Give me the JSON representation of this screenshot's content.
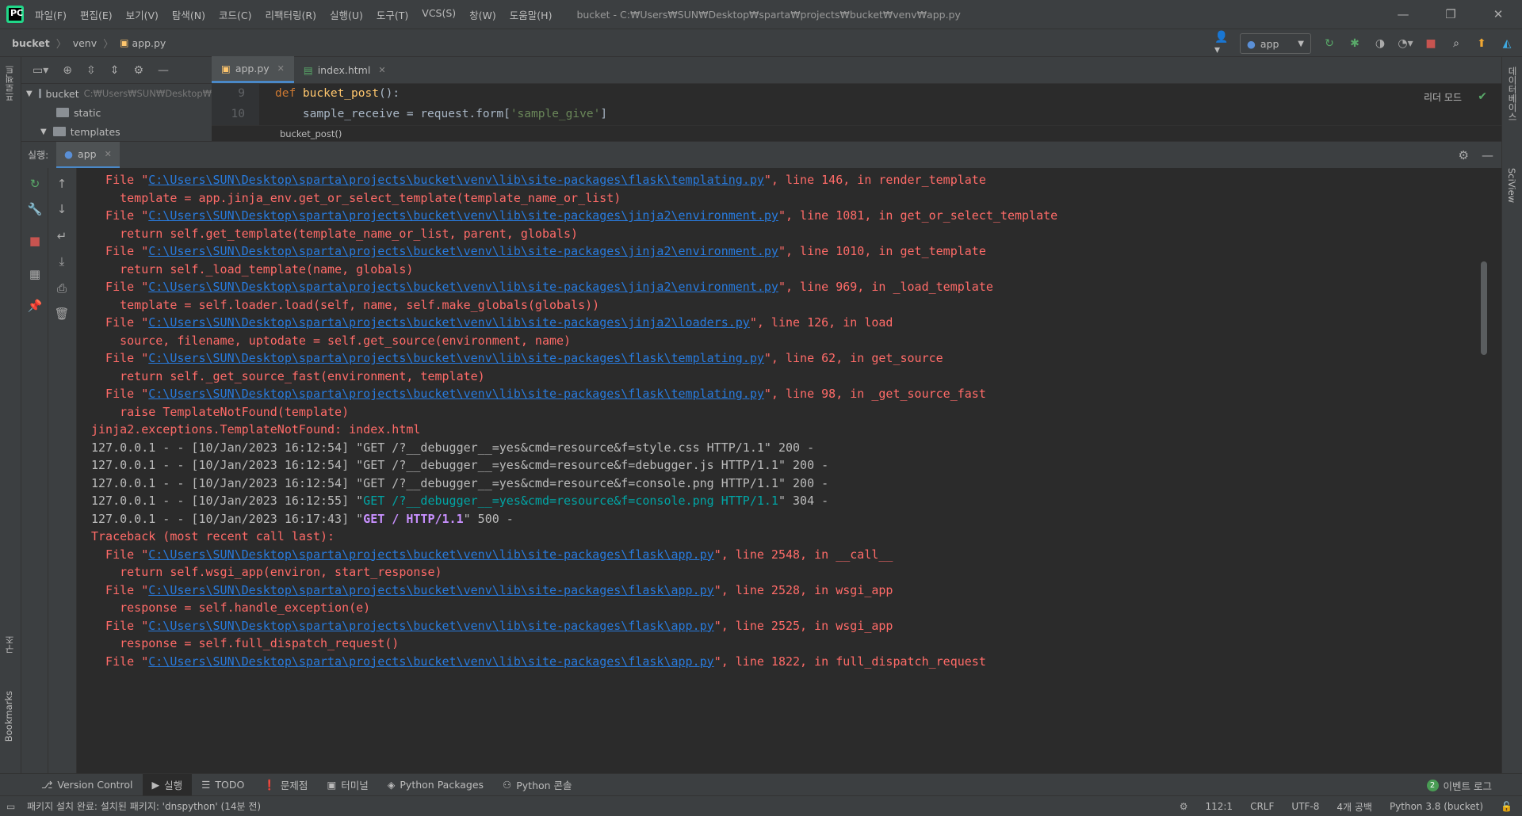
{
  "menu": [
    "파일(F)",
    "편집(E)",
    "보기(V)",
    "탐색(N)",
    "코드(C)",
    "리팩터링(R)",
    "실행(U)",
    "도구(T)",
    "VCS(S)",
    "창(W)",
    "도움말(H)"
  ],
  "window_title": "bucket - C:₩Users₩SUN₩Desktop₩sparta₩projects₩bucket₩venv₩app.py",
  "breadcrumb": [
    "bucket",
    "venv",
    "app.py"
  ],
  "run_config": "app",
  "left_strip": {
    "project": "프로젝트",
    "structure": "구조",
    "bookmarks": "Bookmarks"
  },
  "right_strip": {
    "database": "데이터베이스",
    "sciview": "SciView"
  },
  "editor_tabs": [
    {
      "label": "app.py"
    },
    {
      "label": "index.html"
    }
  ],
  "project_tree": {
    "root": "bucket",
    "root_path": "C:₩Users₩SUN₩Desktop₩",
    "items": [
      "static",
      "templates"
    ]
  },
  "editor": {
    "lines": [
      {
        "no": "9",
        "code": "def bucket_post():"
      },
      {
        "no": "10",
        "code": "    sample_receive = request.form['sample_give']"
      }
    ],
    "reader_mode": "리더 모드",
    "breadcrumb_fn": "bucket_post()"
  },
  "run_window": {
    "label": "실행:",
    "tab": "app"
  },
  "console": [
    {
      "kind": "file",
      "path": "C:\\Users\\SUN\\Desktop\\sparta\\projects\\bucket\\venv\\lib\\site-packages\\flask\\templating.py",
      "rest": "\", line 146, in render_template"
    },
    {
      "kind": "code",
      "text": "    template = app.jinja_env.get_or_select_template(template_name_or_list)"
    },
    {
      "kind": "file",
      "path": "C:\\Users\\SUN\\Desktop\\sparta\\projects\\bucket\\venv\\lib\\site-packages\\jinja2\\environment.py",
      "rest": "\", line 1081, in get_or_select_template"
    },
    {
      "kind": "code",
      "text": "    return self.get_template(template_name_or_list, parent, globals)"
    },
    {
      "kind": "file",
      "path": "C:\\Users\\SUN\\Desktop\\sparta\\projects\\bucket\\venv\\lib\\site-packages\\jinja2\\environment.py",
      "rest": "\", line 1010, in get_template"
    },
    {
      "kind": "code",
      "text": "    return self._load_template(name, globals)"
    },
    {
      "kind": "file",
      "path": "C:\\Users\\SUN\\Desktop\\sparta\\projects\\bucket\\venv\\lib\\site-packages\\jinja2\\environment.py",
      "rest": "\", line 969, in _load_template"
    },
    {
      "kind": "code",
      "text": "    template = self.loader.load(self, name, self.make_globals(globals))"
    },
    {
      "kind": "file",
      "path": "C:\\Users\\SUN\\Desktop\\sparta\\projects\\bucket\\venv\\lib\\site-packages\\jinja2\\loaders.py",
      "rest": "\", line 126, in load"
    },
    {
      "kind": "code",
      "text": "    source, filename, uptodate = self.get_source(environment, name)"
    },
    {
      "kind": "file",
      "path": "C:\\Users\\SUN\\Desktop\\sparta\\projects\\bucket\\venv\\lib\\site-packages\\flask\\templating.py",
      "rest": "\", line 62, in get_source"
    },
    {
      "kind": "code",
      "text": "    return self._get_source_fast(environment, template)"
    },
    {
      "kind": "file",
      "path": "C:\\Users\\SUN\\Desktop\\sparta\\projects\\bucket\\venv\\lib\\site-packages\\flask\\templating.py",
      "rest": "\", line 98, in _get_source_fast"
    },
    {
      "kind": "code",
      "text": "    raise TemplateNotFound(template)"
    },
    {
      "kind": "plain",
      "text": "jinja2.exceptions.TemplateNotFound: index.html"
    },
    {
      "kind": "plain",
      "text": "127.0.0.1 - - [10/Jan/2023 16:12:54] \"GET /?__debugger__=yes&cmd=resource&f=style.css HTTP/1.1\" 200 -"
    },
    {
      "kind": "plain",
      "text": "127.0.0.1 - - [10/Jan/2023 16:12:54] \"GET /?__debugger__=yes&cmd=resource&f=debugger.js HTTP/1.1\" 200 -"
    },
    {
      "kind": "plain",
      "text": "127.0.0.1 - - [10/Jan/2023 16:12:54] \"GET /?__debugger__=yes&cmd=resource&f=console.png HTTP/1.1\" 200 -"
    },
    {
      "kind": "cyan",
      "pre": "127.0.0.1 - - [10/Jan/2023 16:12:55] \"",
      "mid": "GET /?__debugger__=yes&cmd=resource&f=console.png HTTP/1.1",
      "post": "\" 304 -"
    },
    {
      "kind": "bold",
      "pre": "127.0.0.1 - - [10/Jan/2023 16:17:43] \"",
      "mid": "GET / HTTP/1.1",
      "post": "\" 500 -"
    },
    {
      "kind": "plain",
      "text": "Traceback (most recent call last):"
    },
    {
      "kind": "file",
      "path": "C:\\Users\\SUN\\Desktop\\sparta\\projects\\bucket\\venv\\lib\\site-packages\\flask\\app.py",
      "rest": "\", line 2548, in __call__"
    },
    {
      "kind": "code",
      "text": "    return self.wsgi_app(environ, start_response)"
    },
    {
      "kind": "file",
      "path": "C:\\Users\\SUN\\Desktop\\sparta\\projects\\bucket\\venv\\lib\\site-packages\\flask\\app.py",
      "rest": "\", line 2528, in wsgi_app"
    },
    {
      "kind": "code",
      "text": "    response = self.handle_exception(e)"
    },
    {
      "kind": "file",
      "path": "C:\\Users\\SUN\\Desktop\\sparta\\projects\\bucket\\venv\\lib\\site-packages\\flask\\app.py",
      "rest": "\", line 2525, in wsgi_app"
    },
    {
      "kind": "code",
      "text": "    response = self.full_dispatch_request()"
    },
    {
      "kind": "file",
      "path": "C:\\Users\\SUN\\Desktop\\sparta\\projects\\bucket\\venv\\lib\\site-packages\\flask\\app.py",
      "rest": "\", line 1822, in full_dispatch_request"
    }
  ],
  "bottom_tabs": [
    "Version Control",
    "실행",
    "TODO",
    "문제점",
    "터미널",
    "Python Packages",
    "Python 콘솔"
  ],
  "event_log": {
    "count": "2",
    "label": "이벤트 로그"
  },
  "status": {
    "message": "패키지 설치 완료: 설치된 패키지: 'dnspython' (14분 전)",
    "position": "112:1",
    "line_sep": "CRLF",
    "encoding": "UTF-8",
    "indent": "4개 공백",
    "interpreter": "Python 3.8 (bucket)"
  },
  "colors": {
    "error": "#ff6b68",
    "link": "#287bde",
    "accent": "#4a88c7"
  }
}
